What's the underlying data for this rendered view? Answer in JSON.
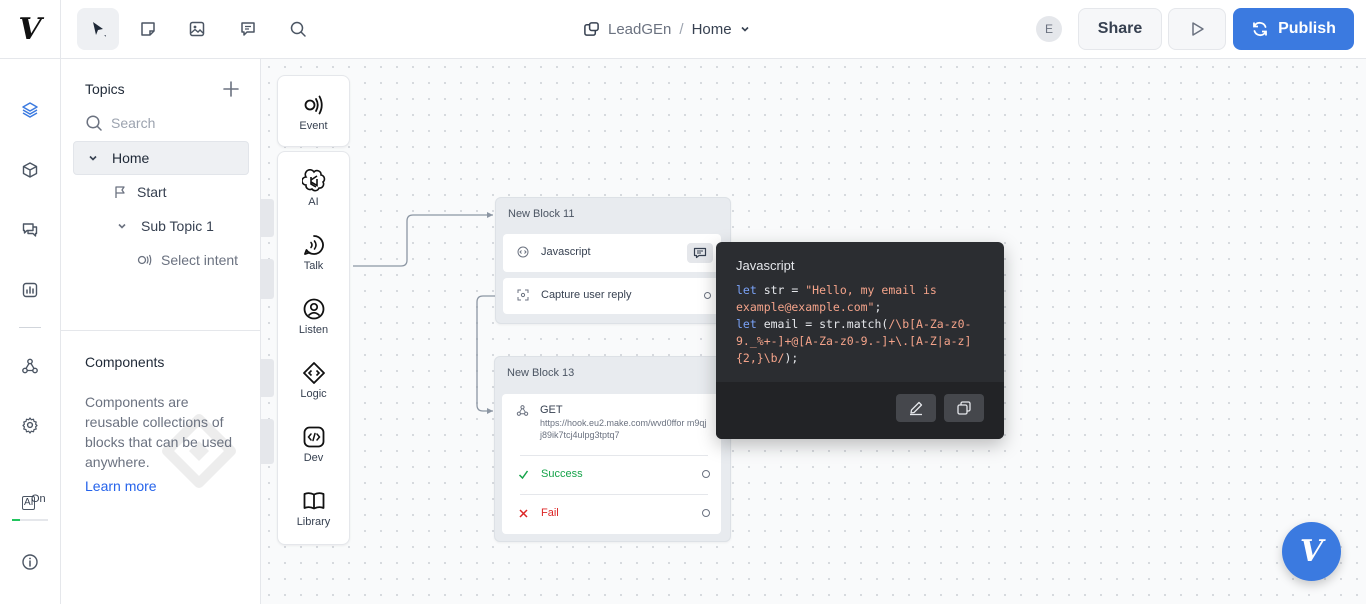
{
  "app": {
    "logo_letter": "V"
  },
  "breadcrumb": {
    "project": "LeadGEn",
    "separator": "/",
    "page": "Home"
  },
  "toolbar": {
    "tools": [
      "select-icon",
      "note-icon",
      "image-icon",
      "comment-icon",
      "search-icon"
    ]
  },
  "header_actions": {
    "avatar_initial": "E",
    "share_label": "Share",
    "publish_label": "Publish"
  },
  "rail": {
    "icons": [
      "layers-icon",
      "cube-icon",
      "chat-icon",
      "analytics-icon",
      "integrations-icon",
      "settings-icon",
      "info-icon"
    ],
    "ai_label": "AI",
    "ai_state": "On"
  },
  "sidebar": {
    "topics_title": "Topics",
    "search_placeholder": "Search",
    "tree": {
      "home": "Home",
      "start": "Start",
      "sub_topic": "Sub Topic 1",
      "select_intent": "Select intent"
    },
    "components_title": "Components",
    "components_desc": "Components are reusable collections of blocks that can be used anywhere.",
    "learn_more": "Learn more"
  },
  "palette": {
    "event": "Event",
    "ai": "AI",
    "talk": "Talk",
    "listen": "Listen",
    "logic": "Logic",
    "dev": "Dev",
    "library": "Library"
  },
  "blocks": {
    "block11": {
      "title": "New Block 11",
      "step1": "Javascript",
      "step2": "Capture user reply"
    },
    "block13": {
      "title": "New Block 13",
      "method": "GET",
      "url": "https://hook.eu2.make.com/wvd0ffor m9qjj89ik7tcj4ulpg3tptq7",
      "success": "Success",
      "fail": "Fail"
    }
  },
  "tooltip": {
    "title": "Javascript",
    "code": {
      "l1_kw": "let",
      "l1_var": " str = ",
      "l1_str": "\"Hello, my email is example@example.com\"",
      "l1_end": ";",
      "l2_kw": "let",
      "l2_rest": " email = str.match(",
      "l2_regex": "/\\b[A-Za-z0-9._%+-]+@[A-Za-z0-9.-]+\\.[A-Z|a-z]{2,}\\b/",
      "l2_end": ");"
    }
  },
  "colors": {
    "accent": "#3b7ae0",
    "success": "#16a34a",
    "fail": "#dc2626",
    "tooltip_bg": "#2b2d31"
  }
}
